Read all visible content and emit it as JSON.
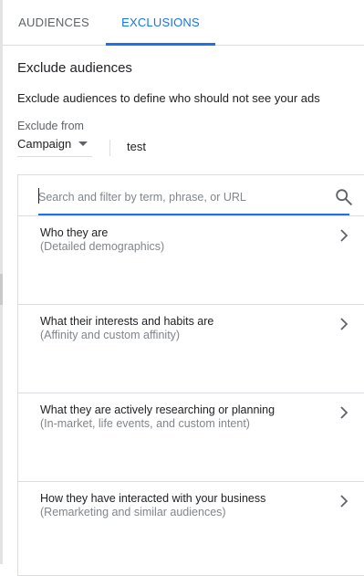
{
  "tabs": [
    {
      "label": "AUDIENCES",
      "active": false
    },
    {
      "label": "EXCLUSIONS",
      "active": true
    }
  ],
  "section": {
    "title": "Exclude audiences",
    "description": "Exclude audiences to define who should not see your ads"
  },
  "exclude_from": {
    "label": "Exclude from",
    "selected": "Campaign",
    "campaign_name": "test"
  },
  "search": {
    "placeholder": "Search and filter by term, phrase, or URL",
    "value": ""
  },
  "categories": [
    {
      "title": "Who they are",
      "subtitle": "(Detailed demographics)"
    },
    {
      "title": "What their interests and habits are",
      "subtitle": "(Affinity and custom affinity)"
    },
    {
      "title": "What they are actively researching or planning",
      "subtitle": "(In-market, life events, and custom intent)"
    },
    {
      "title": "How they have interacted with your business",
      "subtitle": "(Remarketing and similar audiences)"
    }
  ],
  "icons": {
    "search": "search-icon",
    "chevron": "chevron-right-icon",
    "dropdown": "caret-down-icon"
  },
  "colors": {
    "accent": "#1a73e8",
    "text": "#202124",
    "secondary_text": "#80868b",
    "divider": "#dadce0"
  }
}
